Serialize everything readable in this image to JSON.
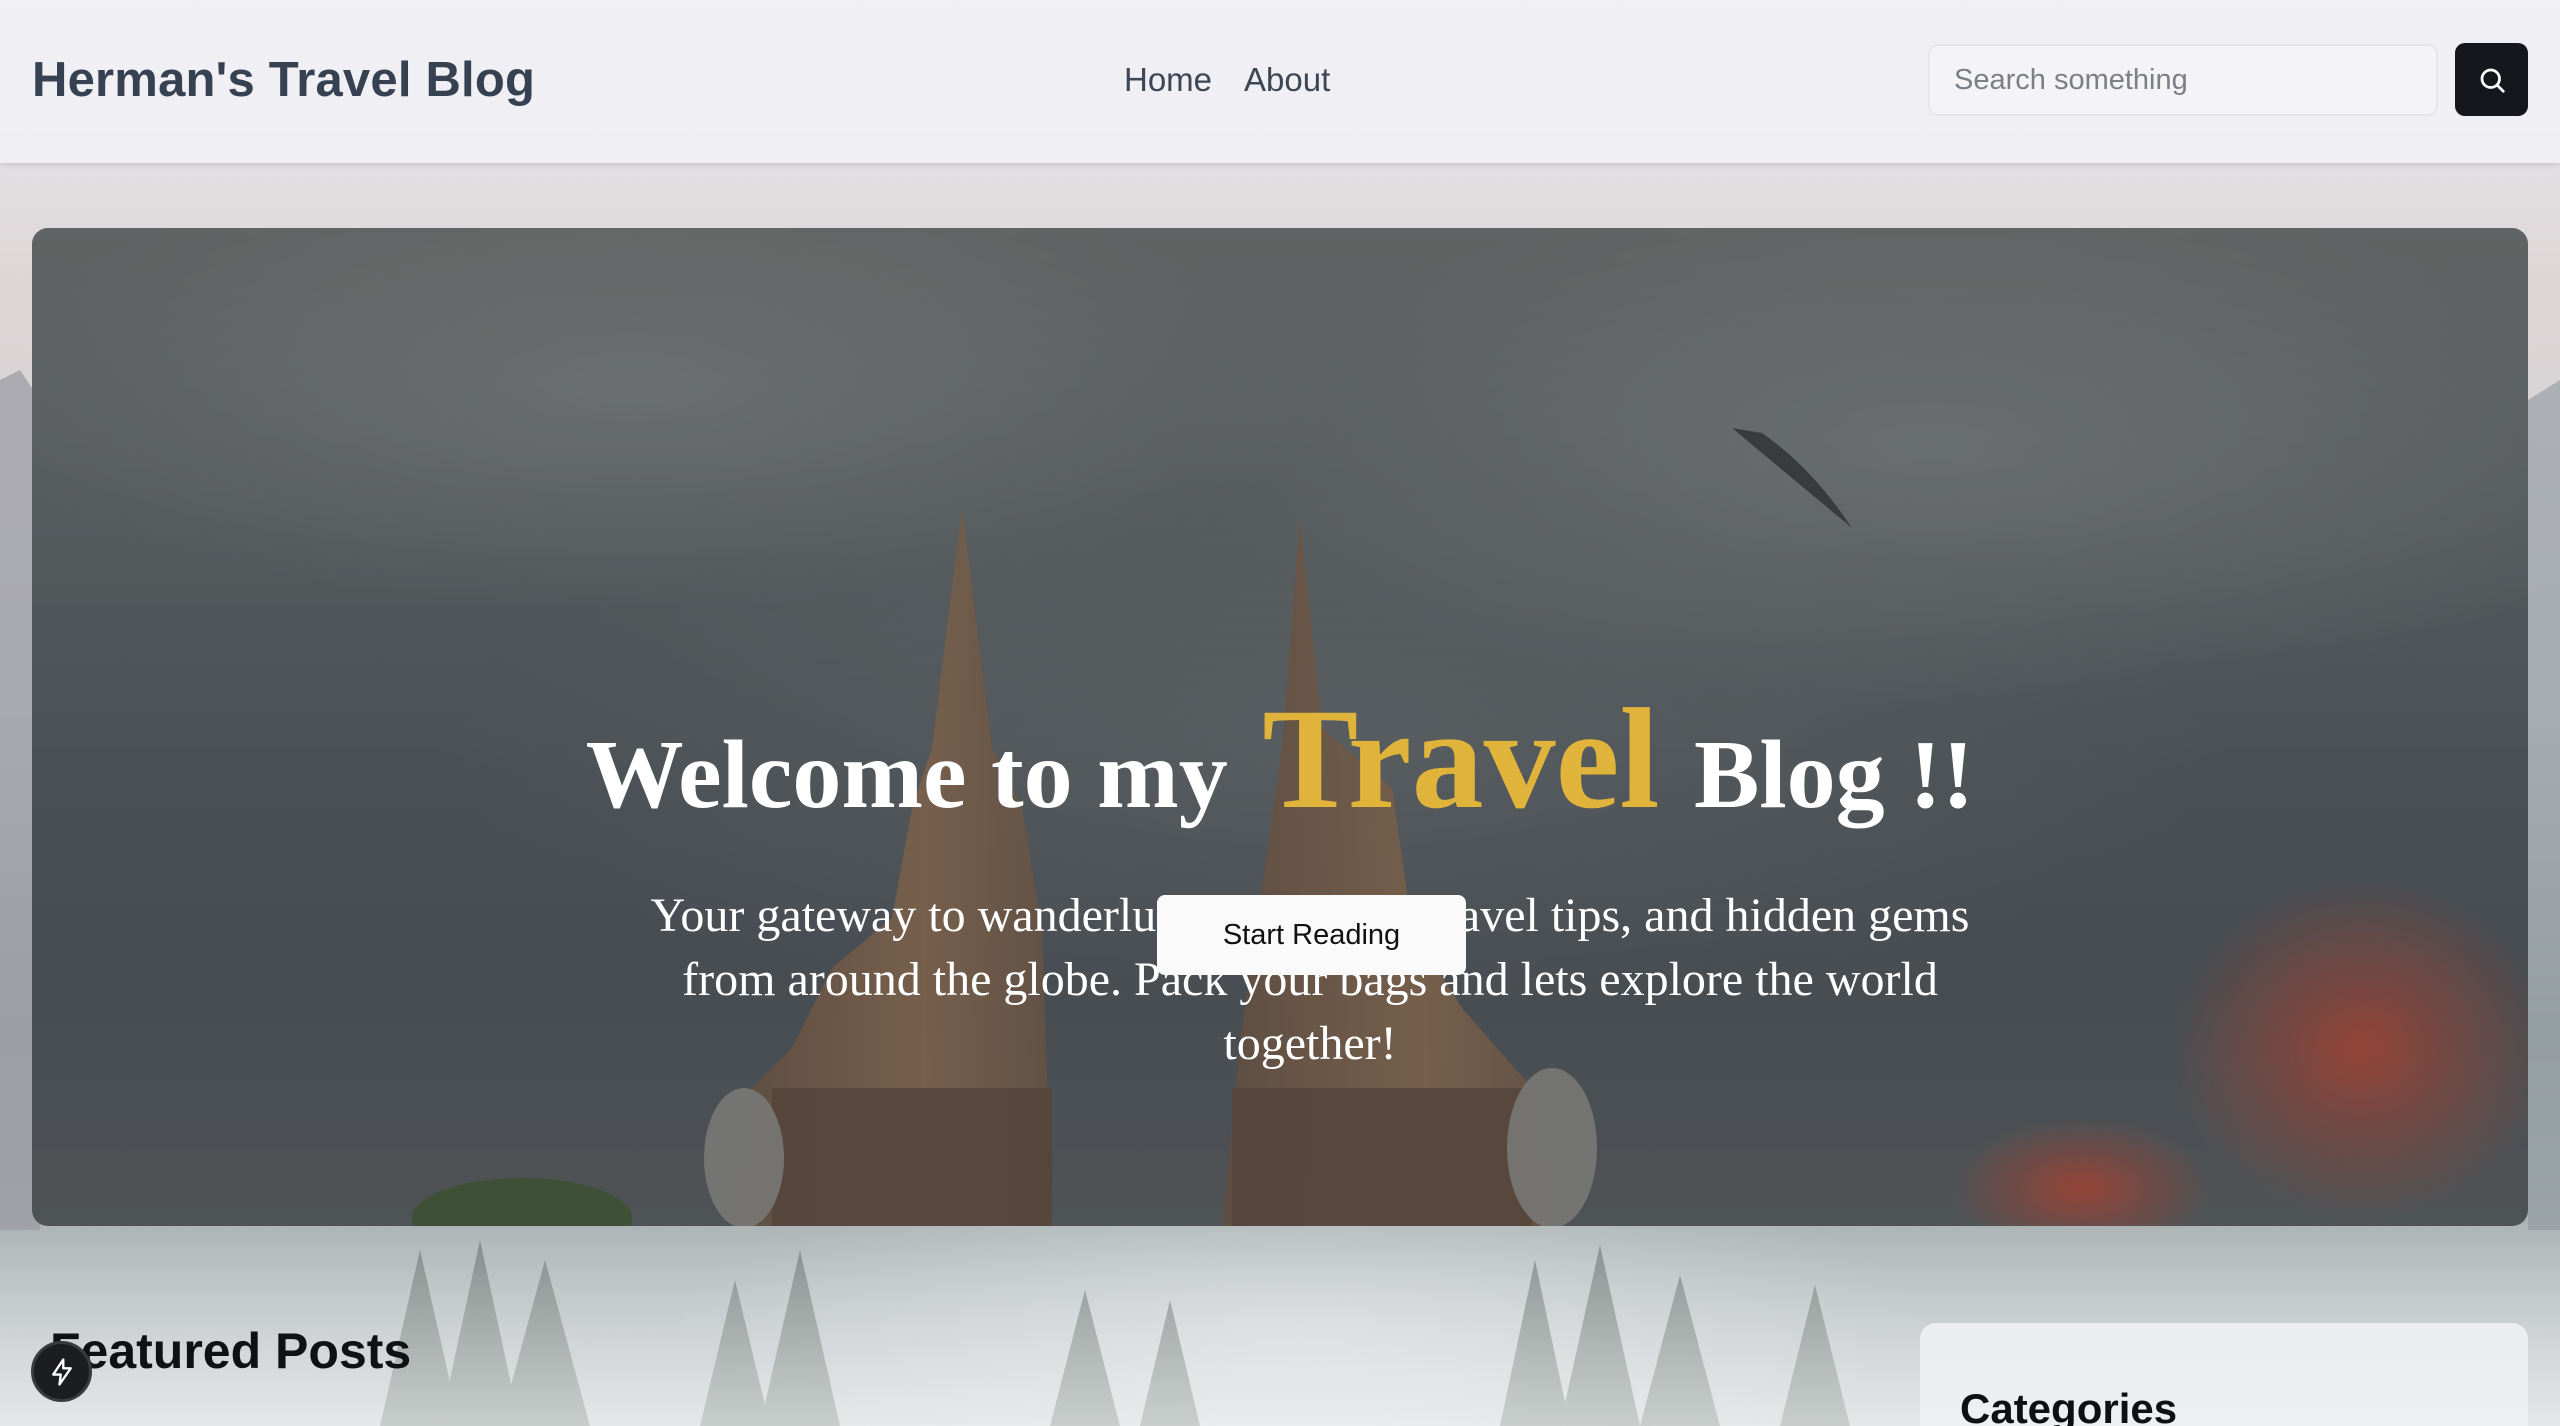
{
  "header": {
    "brand": "Herman's Travel Blog",
    "nav": [
      {
        "label": "Home"
      },
      {
        "label": "About"
      }
    ],
    "search": {
      "placeholder": "Search something",
      "icon": "search-icon"
    }
  },
  "hero": {
    "title_before": "Welcome to my ",
    "title_accent": "Travel",
    "title_after": " Blog !!",
    "subtitle": "Your gateway to wanderlust inspiration, travel tips, and hidden gems from around the globe. Pack your bags and lets explore the world together!",
    "cta_label": "Start Reading",
    "accent_color": "#e0b43a"
  },
  "featured": {
    "heading": "Featured Posts"
  },
  "sidebar": {
    "categories_title": "Categories"
  },
  "floating_action": {
    "icon": "lightning-icon"
  }
}
